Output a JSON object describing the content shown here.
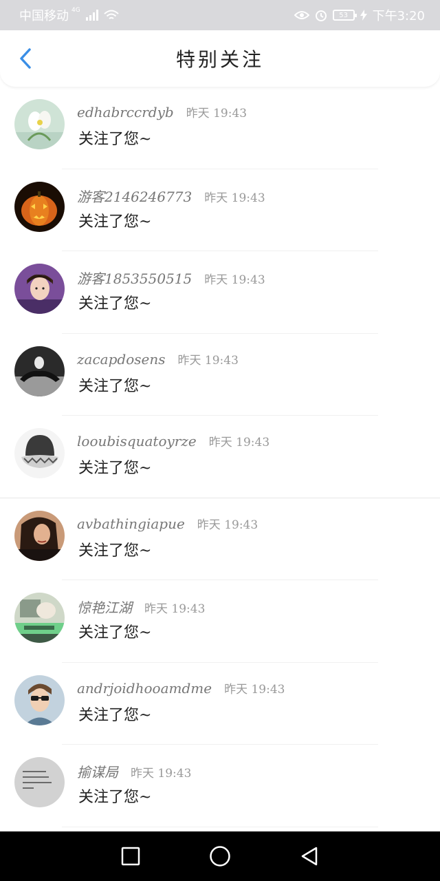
{
  "status_bar": {
    "carrier": "中国移动",
    "network": "4G",
    "battery": "53",
    "time": "下午3:20"
  },
  "header": {
    "title": "特别关注"
  },
  "items": [
    {
      "name": "edhabrccrdyb",
      "time": "昨天 19:43",
      "message": "关注了您~",
      "avatar": "flower"
    },
    {
      "name": "游客2146246773",
      "time": "昨天 19:43",
      "message": "关注了您~",
      "avatar": "pumpkin"
    },
    {
      "name": "游客1853550515",
      "time": "昨天 19:43",
      "message": "关注了您~",
      "avatar": "portrait-purple"
    },
    {
      "name": "zacapdosens",
      "time": "昨天 19:43",
      "message": "关注了您~",
      "avatar": "silhouette-bw"
    },
    {
      "name": "looubisquatoyrze",
      "time": "昨天 19:43",
      "message": "关注了您~",
      "avatar": "hat"
    },
    {
      "name": "avbathingiapue",
      "time": "昨天 19:43",
      "message": "关注了您~",
      "avatar": "woman-warm"
    },
    {
      "name": "惊艳江湖",
      "time": "昨天 19:43",
      "message": "关注了您~",
      "avatar": "green-photo"
    },
    {
      "name": "andrjoidhooamdme",
      "time": "昨天 19:43",
      "message": "关注了您~",
      "avatar": "man-sunglasses"
    },
    {
      "name": "揄谋局",
      "time": "昨天 19:43",
      "message": "关注了您~",
      "avatar": "text-gray"
    }
  ],
  "colors": {
    "accent": "#3a8ee6",
    "status_bar_bg": "#d9d9dc",
    "nav_bar_bg": "#000000"
  }
}
